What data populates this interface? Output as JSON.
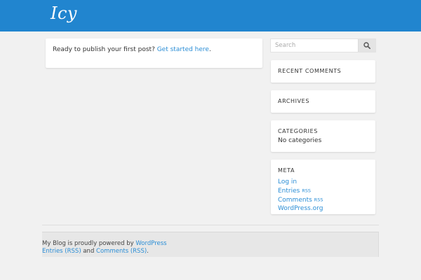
{
  "header": {
    "site_title": "Icy"
  },
  "post": {
    "message": "Ready to publish your first post? ",
    "link_label": "Get started here",
    "suffix": "."
  },
  "search": {
    "placeholder": "Search",
    "icon": "search-icon"
  },
  "widgets": {
    "recent_comments": {
      "title": "RECENT COMMENTS"
    },
    "archives": {
      "title": "ARCHIVES"
    },
    "categories": {
      "title": "CATEGORIES",
      "empty_text": "No categories"
    },
    "meta": {
      "title": "META",
      "links": [
        {
          "label": "Log in"
        },
        {
          "label": "Entries",
          "badge": "RSS"
        },
        {
          "label": "Comments",
          "badge": "RSS"
        },
        {
          "label": "WordPress.org"
        }
      ]
    }
  },
  "footer": {
    "powered_prefix": "My Blog is proudly powered by ",
    "powered_link": "WordPress",
    "entries_link": "Entries (RSS)",
    "and_text": " and ",
    "comments_link": "Comments (RSS)",
    "end_text": "."
  },
  "colors": {
    "header_bg": "#2185cf",
    "link": "#2b8ed6",
    "page_bg": "#f1f1f1"
  }
}
